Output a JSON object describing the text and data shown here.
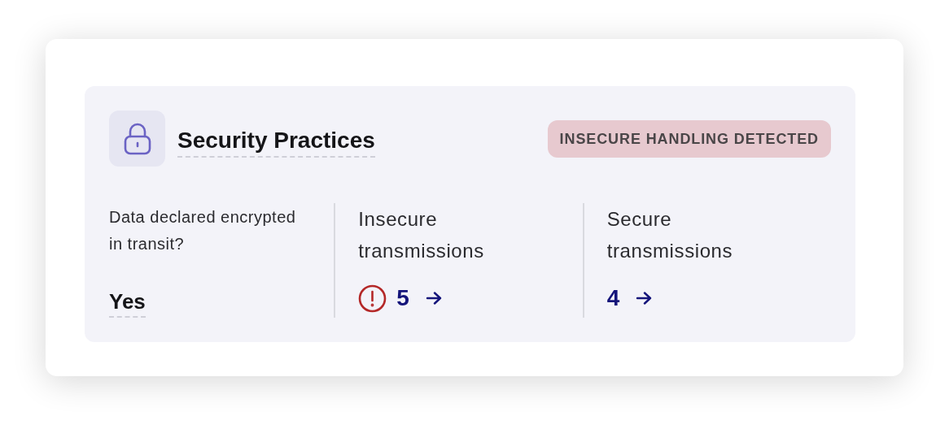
{
  "header": {
    "title": "Security Practices",
    "badge": "INSECURE HANDLING DETECTED"
  },
  "columns": [
    {
      "kind": "answer",
      "label": "Data declared encrypted in transit?",
      "value": "Yes"
    },
    {
      "kind": "count",
      "label": "Insecure transmissions",
      "value": "5",
      "warning": true
    },
    {
      "kind": "count",
      "label": "Secure transmissions",
      "value": "4",
      "warning": false
    }
  ]
}
